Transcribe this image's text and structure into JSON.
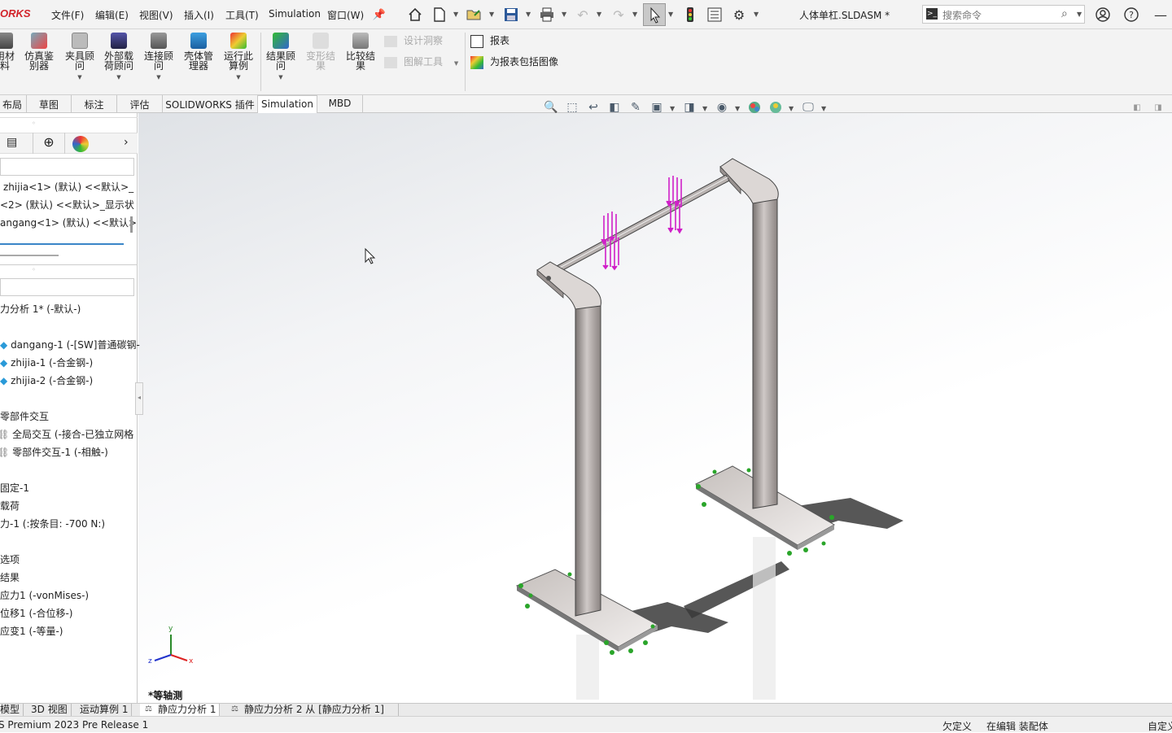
{
  "app": {
    "logo": "ORKS",
    "document_title": "人体单杠.SLDASM *"
  },
  "menu": [
    "文件(F)",
    "编辑(E)",
    "视图(V)",
    "插入(I)",
    "工具(T)",
    "Simulation",
    "窗口(W)"
  ],
  "search": {
    "placeholder": "搜索命令"
  },
  "ribbon": {
    "buttons": [
      {
        "label": "用材\n料",
        "enabled": true
      },
      {
        "label": "仿真鉴\n别器",
        "enabled": true
      },
      {
        "label": "夹具顾\n问",
        "enabled": true
      },
      {
        "label": "外部载\n荷顾问",
        "enabled": true
      },
      {
        "label": "连接顾\n问",
        "enabled": true
      },
      {
        "label": "壳体管\n理器",
        "enabled": true
      },
      {
        "label": "运行此\n算例",
        "enabled": true
      },
      {
        "label": "结果顾\n问",
        "enabled": true
      },
      {
        "label": "变形结\n果",
        "enabled": false
      },
      {
        "label": "比较结\n果",
        "enabled": true
      }
    ],
    "small": {
      "design_insight": "设计洞察",
      "plot_tools": "图解工具",
      "report": "报表",
      "include_image": "为报表包括图像"
    }
  },
  "tabs": [
    "布局",
    "草图",
    "标注",
    "评估",
    "SOLIDWORKS 插件",
    "Simulation",
    "MBD"
  ],
  "active_tab": "Simulation",
  "tree_top": {
    "items": [
      "zhijia<1> (默认) <<默认>_",
      "<2> (默认) <<默认>_显示状",
      "angang<1> (默认) <<默认>"
    ]
  },
  "sim_tree": {
    "study": "力分析 1* (-默认-)",
    "parts": [
      "dangang-1 (-[SW]普通碳钢-",
      "zhijia-1 (-合金钢-)",
      "zhijia-2 (-合金钢-)"
    ],
    "interactions_header": "零部件交互",
    "interactions": [
      "全局交互 (-接合-已独立网格",
      "零部件交互-1 (-相触-)"
    ],
    "fixture": "固定-1",
    "loads_header": "载荷",
    "load": "力-1 (:按条目: -700 N:)",
    "options": "选项",
    "results_header": "结果",
    "results": [
      "应力1 (-vonMises-)",
      "位移1 (-合位移-)",
      "应变1 (-等量-)"
    ]
  },
  "viewport": {
    "view_label": "*等轴测",
    "triad": {
      "x": "x",
      "y": "y",
      "z": "z"
    }
  },
  "bottom_tabs": [
    "模型",
    "3D 视图",
    "运动算例 1",
    "静应力分析 1",
    "静应力分析 2 从 [静应力分析 1]"
  ],
  "active_bottom_tab": "静应力分析 1",
  "status": {
    "left": "S Premium 2023 Pre Release 1",
    "state1": "欠定义",
    "state2": "在编辑 装配体",
    "right": "自定义"
  },
  "colors": {
    "load_arrows": "#d020c8",
    "fixtures": "#22aa22",
    "part": "#a9a3a1",
    "logo": "#d2232a"
  }
}
